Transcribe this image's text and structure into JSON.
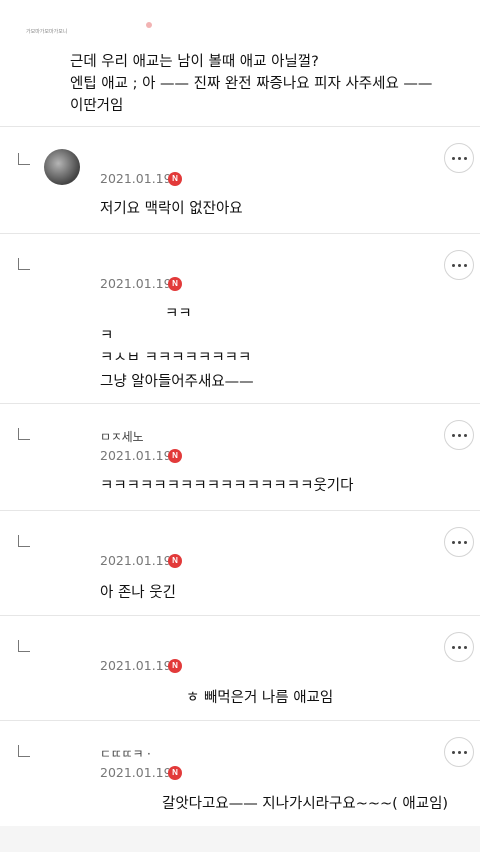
{
  "top": {
    "tiny_text": "가모마가모마가모니"
  },
  "first_comment": {
    "lines": [
      "근데 우리 애교는 남이 볼때 애교 아닐껄?",
      "엔팁 애교 ; 아 —— 진짜 완전 짜증나요 피자 사주세요 ——",
      "이딴거임"
    ]
  },
  "replies": [
    {
      "nickname": "",
      "date": "2021.01.19",
      "badge": "N",
      "lines": [
        "저기요 맥락이 없잔아요"
      ]
    },
    {
      "nickname": "",
      "date": "2021.01.19",
      "badge": "N",
      "lines": [
        "ㅋㅋ",
        "ㅋ",
        "ㅋㅅㅂ ㅋㅋㅋㅋㅋㅋㅋㅋ",
        "그냥 알아들어주새요——"
      ]
    },
    {
      "nickname": "ㅁㅈ세노",
      "date": "2021.01.19",
      "badge": "N",
      "lines": [
        "ㅋㅋㅋㅋㅋㅋㅋㅋㅋㅋㅋㅋㅋㅋㅋㅋ웃기다"
      ]
    },
    {
      "nickname": "",
      "date": "2021.01.19",
      "badge": "N",
      "lines": [
        "아 존나 웃긴"
      ]
    },
    {
      "nickname": "",
      "date": "2021.01.19",
      "badge": "N",
      "lines": [
        "ㅎ 빼먹은거 나름 애교임"
      ]
    },
    {
      "nickname": "ㄷㄸㄸㅋ ·",
      "date": "2021.01.19",
      "badge": "N",
      "lines": [
        "갈앗다고요—— 지나가시라구요~~~( 애교임)"
      ]
    }
  ]
}
